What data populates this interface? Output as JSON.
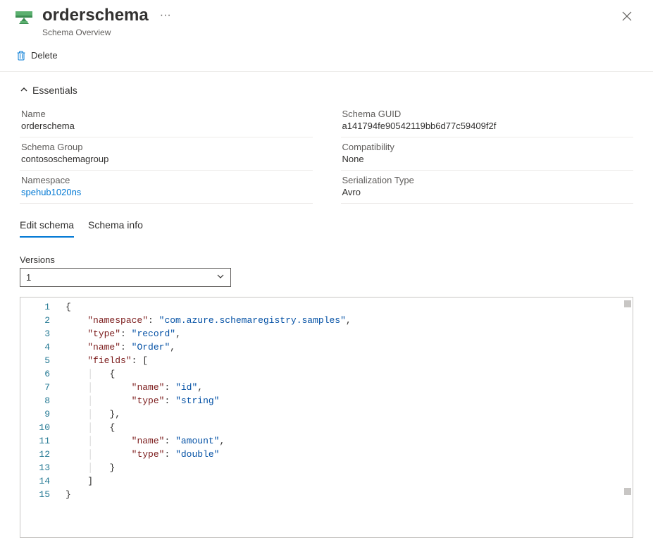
{
  "header": {
    "title": "orderschema",
    "subtitle": "Schema Overview",
    "more": "···"
  },
  "toolbar": {
    "delete_label": "Delete"
  },
  "essentials": {
    "toggle_label": "Essentials",
    "left": [
      {
        "label": "Name",
        "value": "orderschema"
      },
      {
        "label": "Schema Group",
        "value": "contososchemagroup"
      },
      {
        "label": "Namespace",
        "value": "spehub1020ns",
        "link": true
      }
    ],
    "right": [
      {
        "label": "Schema GUID",
        "value": "a141794fe90542119bb6d77c59409f2f"
      },
      {
        "label": "Compatibility",
        "value": "None"
      },
      {
        "label": "Serialization Type",
        "value": "Avro"
      }
    ]
  },
  "tabs": {
    "items": [
      {
        "label": "Edit schema",
        "active": true
      },
      {
        "label": "Schema info",
        "active": false
      }
    ]
  },
  "versions": {
    "label": "Versions",
    "selected": "1"
  },
  "editor": {
    "line_count": 15,
    "schema": {
      "namespace": "com.azure.schemaregistry.samples",
      "type": "record",
      "name": "Order",
      "fields": [
        {
          "name": "id",
          "type": "string"
        },
        {
          "name": "amount",
          "type": "double"
        }
      ]
    }
  }
}
